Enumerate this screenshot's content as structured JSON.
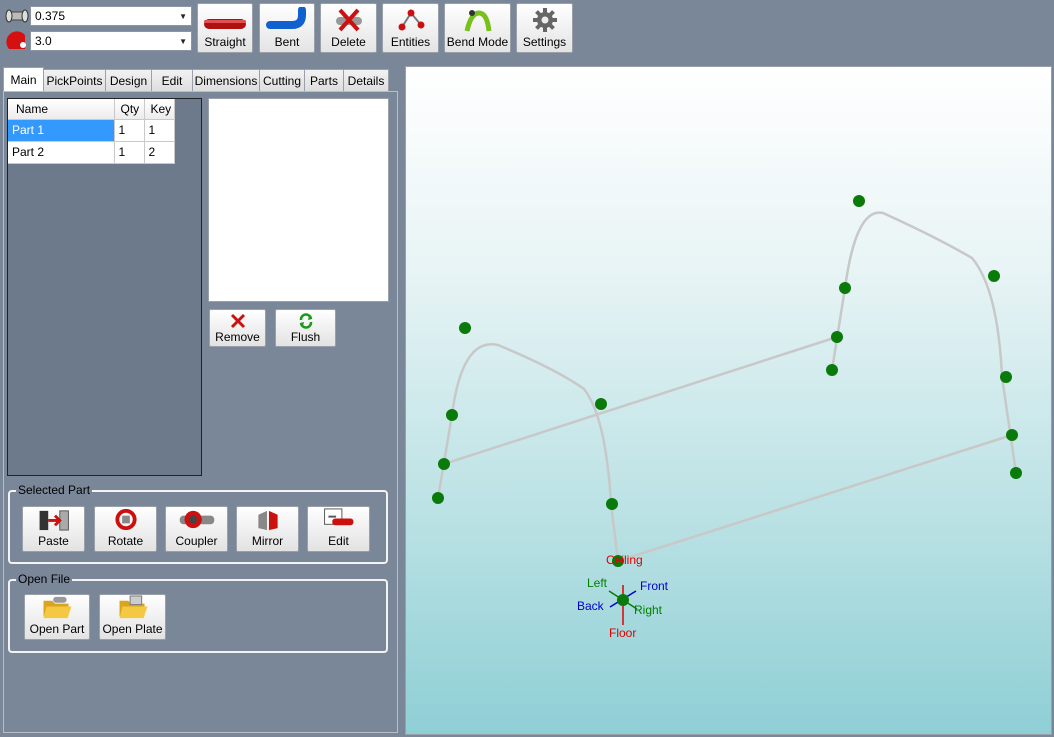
{
  "toolbar": {
    "diameter": {
      "value": "0.375",
      "icon": "pipe-diameter-icon"
    },
    "radius": {
      "value": "3.0",
      "icon": "bend-radius-icon"
    },
    "buttons": {
      "straight": "Straight",
      "bent": "Bent",
      "delete": "Delete",
      "entities": "Entities",
      "bend_mode": "Bend Mode",
      "settings": "Settings"
    }
  },
  "tabs": [
    "Main",
    "PickPoints",
    "Design",
    "Edit",
    "Dimensions",
    "Cutting",
    "Parts",
    "Details"
  ],
  "active_tab": "Main",
  "parts_table": {
    "columns": [
      "Name",
      "Qty",
      "Key"
    ],
    "rows": [
      {
        "name": "Part 1",
        "qty": "1",
        "key": "1",
        "selected": true
      },
      {
        "name": "Part 2",
        "qty": "1",
        "key": "2",
        "selected": false
      }
    ]
  },
  "preview_buttons": {
    "remove": "Remove",
    "flush": "Flush"
  },
  "selected_part": {
    "title": "Selected Part",
    "buttons": {
      "paste": "Paste",
      "rotate": "Rotate",
      "coupler": "Coupler",
      "mirror": "Mirror",
      "edit": "Edit"
    }
  },
  "open_file": {
    "title": "Open File",
    "buttons": {
      "open_part": "Open Part",
      "open_plate": "Open Plate"
    }
  },
  "axes": {
    "ceiling": "Ceiling",
    "floor": "Floor",
    "left": "Left",
    "right": "Right",
    "front": "Front",
    "back": "Back"
  },
  "colors": {
    "pick_point": "#0a7a0a",
    "pipe": "#c8c8c8",
    "axis_red": "#e00000",
    "axis_green": "#008000",
    "axis_blue": "#0000cc",
    "selection": "#3399ff"
  }
}
